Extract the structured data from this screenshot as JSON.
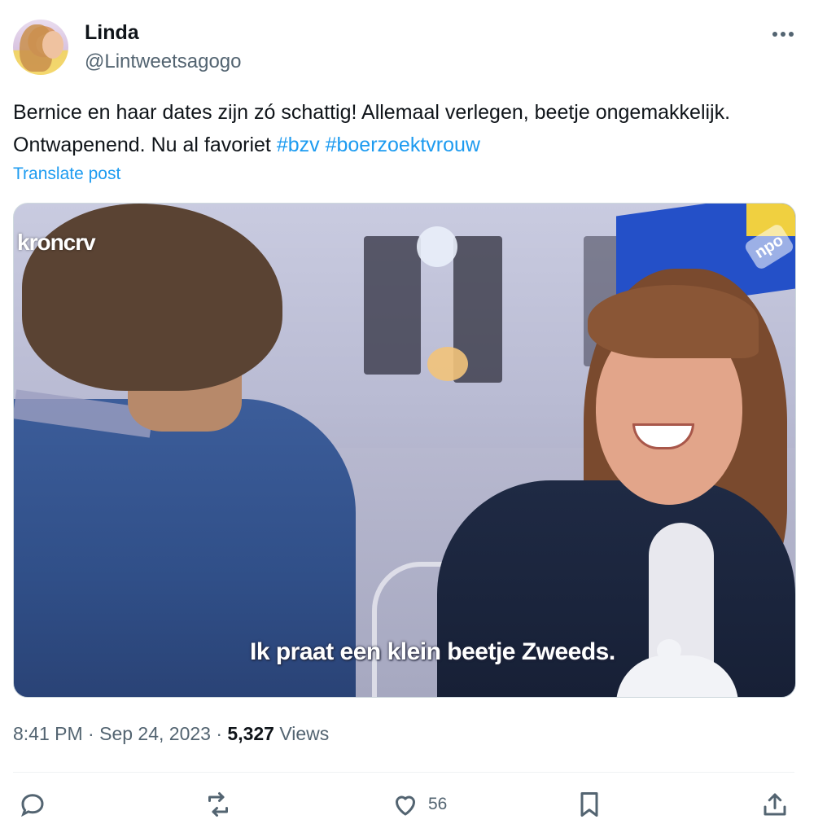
{
  "author": {
    "name": "Linda",
    "handle": "@Lintweetsagogo"
  },
  "tweet": {
    "text_plain": "Bernice en haar dates zijn zó schattig! Allemaal verlegen, beetje ongemakkelijk. Ontwapenend. Nu al favoriet",
    "hashtags": [
      "#bzv",
      "#boerzoektvrouw"
    ],
    "translate_label": "Translate post"
  },
  "media": {
    "subtitle": "Ik praat een klein beetje Zweeds.",
    "channel_logo": "kroncrv",
    "npo_logo": "npo"
  },
  "meta": {
    "time": "8:41 PM",
    "separator": "·",
    "date": "Sep 24, 2023",
    "views_count": "5,327",
    "views_label": "Views"
  },
  "actions": {
    "reply_icon": "reply-icon",
    "repost_icon": "repost-icon",
    "like_icon": "heart-icon",
    "like_count": "56",
    "bookmark_icon": "bookmark-icon",
    "share_icon": "share-icon"
  },
  "colors": {
    "accent": "#1d9bf0",
    "text": "#0f1419",
    "muted": "#536471"
  }
}
